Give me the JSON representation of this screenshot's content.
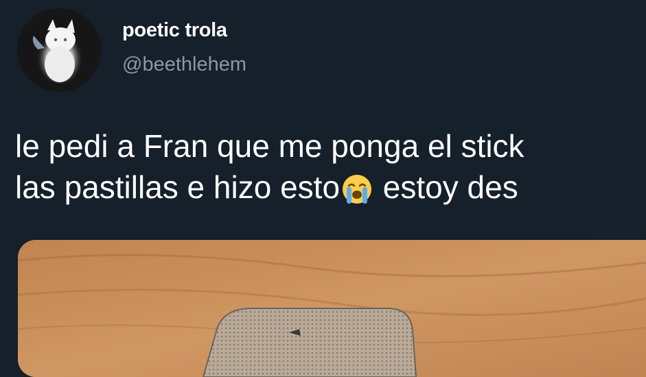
{
  "tweet": {
    "author": {
      "display_name": "poetic trola",
      "handle": "@beethlehem",
      "avatar_icon": "white-kitten-avatar"
    },
    "text": {
      "line1": "le pedi a Fran que me ponga el stick",
      "line2_before": "las pastillas e hizo esto",
      "line2_after": " estoy des",
      "emoji_icon": "loudly-crying-face-emoji"
    },
    "media": {
      "description_icon": "pill-blister-on-wood-photo"
    }
  },
  "colors": {
    "background": "#15202b",
    "text": "#ffffff",
    "secondary_text": "#8899a6",
    "wood": "#c58a55"
  }
}
